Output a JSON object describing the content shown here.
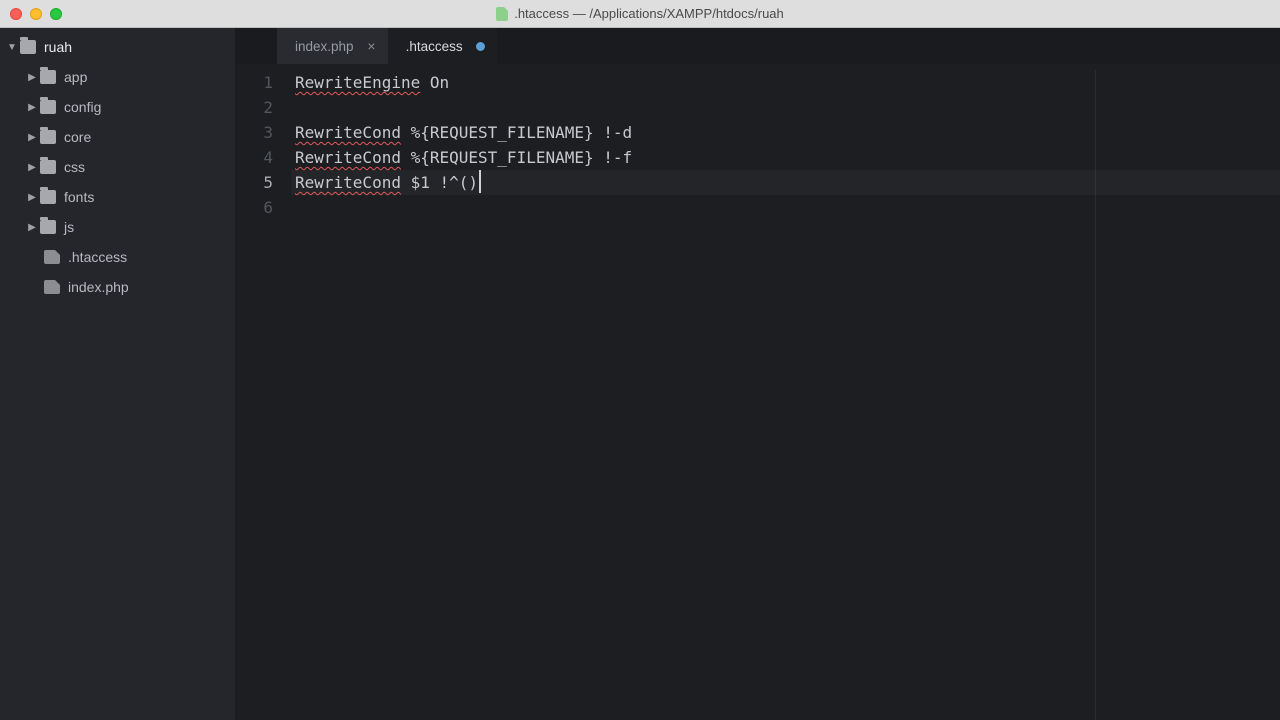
{
  "titlebar": {
    "filename": ".htaccess",
    "separator": "—",
    "path": "/Applications/XAMPP/htdocs/ruah"
  },
  "sidebar": {
    "root": {
      "name": "ruah",
      "expanded": true
    },
    "items": [
      {
        "name": "app",
        "type": "folder",
        "expanded": false
      },
      {
        "name": "config",
        "type": "folder",
        "expanded": false
      },
      {
        "name": "core",
        "type": "folder",
        "expanded": false
      },
      {
        "name": "css",
        "type": "folder",
        "expanded": false
      },
      {
        "name": "fonts",
        "type": "folder",
        "expanded": false
      },
      {
        "name": "js",
        "type": "folder",
        "expanded": false
      },
      {
        "name": ".htaccess",
        "type": "file"
      },
      {
        "name": "index.php",
        "type": "file"
      }
    ]
  },
  "tabs": [
    {
      "label": "index.php",
      "active": false,
      "dirty": false
    },
    {
      "label": ".htaccess",
      "active": true,
      "dirty": true
    }
  ],
  "editor": {
    "current_line": 5,
    "lines": [
      "RewriteEngine On",
      "",
      "RewriteCond %{REQUEST_FILENAME} !-d",
      "RewriteCond %{REQUEST_FILENAME} !-f",
      "RewriteCond $1 !^()",
      ""
    ]
  }
}
